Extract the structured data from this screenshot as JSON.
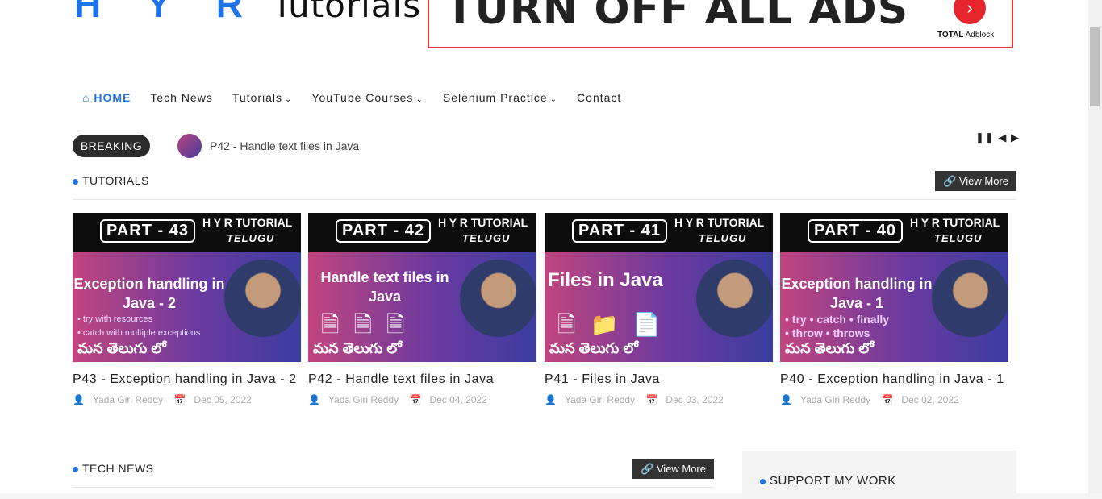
{
  "header": {
    "logo_hyr": "H Y R",
    "logo_tutorials": "Tutorials",
    "ad": {
      "text": "TURN OFF ALL ADS",
      "brand_bold": "TOTAL",
      "brand_rest": "Adblock",
      "button_icon": "chevron-right-icon",
      "accent": "#e6262c"
    }
  },
  "nav": {
    "items": [
      {
        "label": "HOME",
        "icon": "home-icon",
        "active": true
      },
      {
        "label": "Tech News",
        "dropdown": false
      },
      {
        "label": "Tutorials",
        "dropdown": true
      },
      {
        "label": "YouTube Courses",
        "dropdown": true
      },
      {
        "label": "Selenium Practice",
        "dropdown": true
      },
      {
        "label": "Contact",
        "dropdown": false
      }
    ],
    "accent": "#1e73e8"
  },
  "breaking": {
    "label": "BREAKING",
    "text": "P42 - Handle text files in Java",
    "controls": [
      "pause-icon",
      "previous-icon",
      "next-icon"
    ]
  },
  "tutorials": {
    "title": "TUTORIALS",
    "view_more": "View More",
    "cards": [
      {
        "part": "PART - 43",
        "brand": "H Y R TUTORIAL",
        "brand2": "TELUGU",
        "thumb_heading": "Exception handling in Java - 2",
        "thumb_bullets": [
          "• try with resources",
          "• catch with multiple exceptions"
        ],
        "telugu": "మన తెలుగు లో",
        "title": "P43 - Exception handling in Java - 2",
        "author": "Yada Giri Reddy",
        "date": "Dec 05, 2022"
      },
      {
        "part": "PART - 42",
        "brand": "H Y R TUTORIAL",
        "brand2": "TELUGU",
        "thumb_heading": "Handle text files in Java",
        "thumb_bullets": [],
        "telugu": "మన తెలుగు లో",
        "title": "P42 - Handle text files in Java",
        "author": "Yada Giri Reddy",
        "date": "Dec 04, 2022"
      },
      {
        "part": "PART - 41",
        "brand": "H Y R TUTORIAL",
        "brand2": "TELUGU",
        "thumb_heading": "Files in Java",
        "thumb_bullets": [],
        "telugu": "మన తెలుగు లో",
        "title": "P41 - Files in Java",
        "author": "Yada Giri Reddy",
        "date": "Dec 03, 2022"
      },
      {
        "part": "PART - 40",
        "brand": "H Y R TUTORIAL",
        "brand2": "TELUGU",
        "thumb_heading": "Exception handling in Java - 1",
        "thumb_bullets": [
          "• try  • catch  • finally",
          "• throw  • throws"
        ],
        "telugu": "మన తెలుగు లో",
        "title": "P40 - Exception handling in Java - 1",
        "author": "Yada Giri Reddy",
        "date": "Dec 02, 2022"
      }
    ]
  },
  "tech_news": {
    "title": "TECH NEWS",
    "view_more": "View More"
  },
  "sidebar": {
    "support_title": "SUPPORT MY WORK"
  }
}
